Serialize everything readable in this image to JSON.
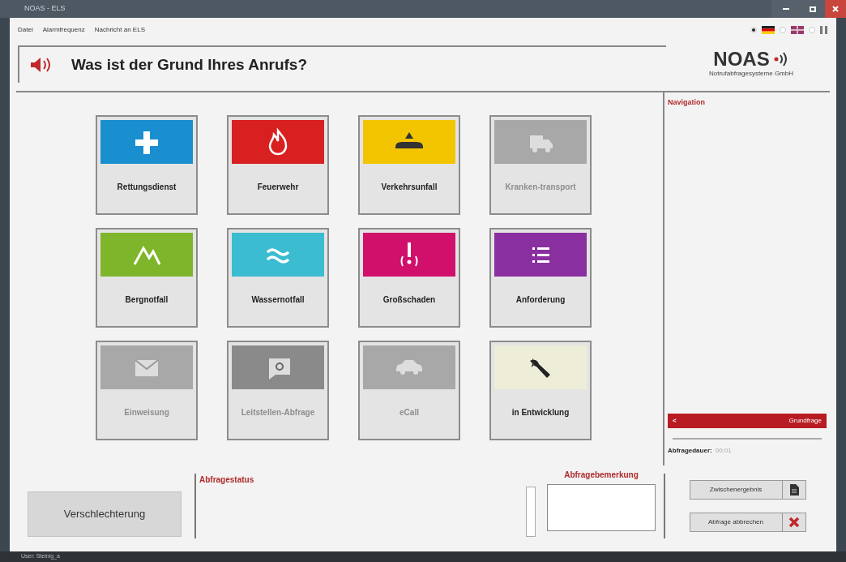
{
  "window": {
    "title": "NOAS - ELS"
  },
  "menu": [
    "Datei",
    "Alarmfrequenz",
    "Nachricht an ELS"
  ],
  "languages": [
    {
      "selected": true
    },
    {
      "selected": false
    },
    {
      "selected": false
    }
  ],
  "question": "Was ist der Grund Ihres Anrufs?",
  "logo": {
    "name": "NOAS",
    "subtitle": "Notrufabfragesysteme GmbH"
  },
  "tiles": [
    {
      "label": "Rettungsdienst",
      "color": "#1a8fd0",
      "disabled": false
    },
    {
      "label": "Feuerwehr",
      "color": "#d92020",
      "disabled": false
    },
    {
      "label": "Verkehrsunfall",
      "color": "#f2c500",
      "disabled": false
    },
    {
      "label": "Kranken-transport",
      "color": "#a8a8a8",
      "disabled": true
    },
    {
      "label": "Bergnotfall",
      "color": "#7fb52a",
      "disabled": false
    },
    {
      "label": "Wassernotfall",
      "color": "#3bbcd0",
      "disabled": false
    },
    {
      "label": "Großschaden",
      "color": "#d0106a",
      "disabled": false
    },
    {
      "label": "Anforderung",
      "color": "#8a2fa0",
      "disabled": false
    },
    {
      "label": "Einweisung",
      "color": "#a8a8a8",
      "disabled": true
    },
    {
      "label": "Leitstellen-Abfrage",
      "color": "#8a8a8a",
      "disabled": true
    },
    {
      "label": "eCall",
      "color": "#a8a8a8",
      "disabled": true
    },
    {
      "label": "in Entwicklung",
      "color": "#eeeed8",
      "disabled": false
    }
  ],
  "navigation": {
    "title": "Navigation",
    "back_arrow": "<",
    "back_label": "Grundfrage",
    "duration_label": "Abfragedauer:",
    "duration": "00:01"
  },
  "bottom": {
    "deterioration_button": "Verschlechterung",
    "status_title": "Abfragestatus",
    "remark_title": "Abfragebemerkung"
  },
  "actions": [
    {
      "label": "Zwischenergebnis"
    },
    {
      "label": "Abfrage abbrechen"
    }
  ],
  "status_bar": "User: Steinig_a"
}
